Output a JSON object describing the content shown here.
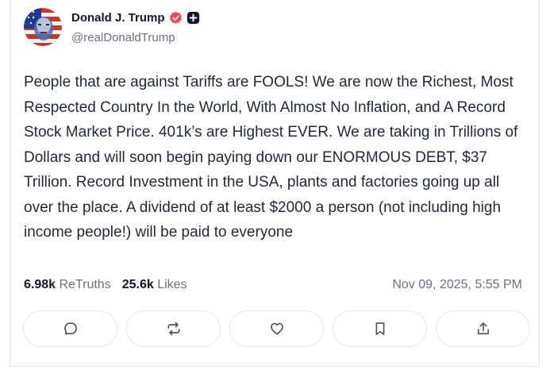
{
  "post": {
    "author_name": "Donald J. Trump",
    "handle": "@realDonaldTrump",
    "verified_icon": "verified-badge-icon",
    "text": "People that are against Tariffs are FOOLS! We are now the Richest, Most Respected Country In the World, With Almost No Inflation, and A Record Stock Market Price. 401k’s are Highest EVER. We are taking in Trillions of Dollars and will soon begin paying down our ENORMOUS DEBT, $37 Trillion. Record Investment in the USA, plants and factories going up all over the place. A dividend of at least $2000 a person (not including high income people!) will be paid to everyone",
    "retruths_count": "6.98k",
    "retruths_label": "ReTruths",
    "likes_count": "25.6k",
    "likes_label": "Likes",
    "timestamp": "Nov 09, 2025, 5:55 PM"
  },
  "actions": [
    {
      "name": "reply",
      "icon": "comment-icon"
    },
    {
      "name": "retruth",
      "icon": "repost-icon"
    },
    {
      "name": "like",
      "icon": "heart-icon"
    },
    {
      "name": "bookmark",
      "icon": "bookmark-icon"
    },
    {
      "name": "share",
      "icon": "share-icon"
    }
  ],
  "colors": {
    "verified_badge": "#f2495c",
    "text_primary": "#111827",
    "text_secondary": "#6b7280",
    "border": "#e5e7eb"
  }
}
